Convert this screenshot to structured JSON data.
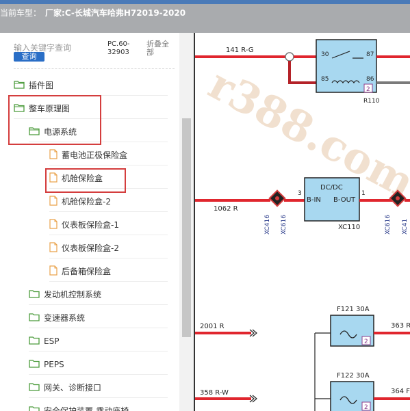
{
  "header": {
    "label": "当前车型：",
    "manufacturer": "厂家:C-长城汽车哈弗H72019-2020"
  },
  "search": {
    "placeholder": "输入关键字查询",
    "button_label": "查询",
    "pc_label": "PC.60-32903",
    "fold_all_label": "折叠全部"
  },
  "tree": {
    "items": [
      {
        "label": "插件图",
        "type": "folder"
      },
      {
        "label": "整车原理图",
        "type": "folder"
      },
      {
        "label": "电源系统",
        "type": "folder"
      },
      {
        "label": "蓄电池正极保险盒",
        "type": "file"
      },
      {
        "label": "机舱保险盒",
        "type": "file"
      },
      {
        "label": "机舱保险盒-2",
        "type": "file"
      },
      {
        "label": "仪表板保险盒-1",
        "type": "file"
      },
      {
        "label": "仪表板保险盒-2",
        "type": "file"
      },
      {
        "label": "后备箱保险盒",
        "type": "file"
      },
      {
        "label": "发动机控制系统",
        "type": "folder"
      },
      {
        "label": "变速器系统",
        "type": "folder"
      },
      {
        "label": "ESP",
        "type": "folder"
      },
      {
        "label": "PEPS",
        "type": "folder"
      },
      {
        "label": "网关、诊断接口",
        "type": "folder"
      },
      {
        "label": "安全保护装置-乘动座椅",
        "type": "folder"
      }
    ]
  },
  "diagram": {
    "relay_name": "R110",
    "relay_pins": [
      "30",
      "87",
      "85",
      "86"
    ],
    "relay_badge": "2",
    "wire_top": "141 R-G",
    "dcdc_title": "DC/DC",
    "dcdc_in": "B-IN",
    "dcdc_out": "B-OUT",
    "dcdc_name": "XC110",
    "dcdc_pin_in": "3",
    "dcdc_pin_out": "1",
    "wire_mid": "1062 R",
    "conn_left_a": "XC416",
    "conn_left_b": "XC616",
    "conn_right_a": "XC616",
    "conn_right_b": "XC41",
    "fuse1_label": "F121 30A",
    "fuse1_badge": "2",
    "fuse2_label": "F122 30A",
    "fuse2_badge": "2",
    "wire_f1_in": "2001 R",
    "wire_f1_out": "363 R",
    "wire_f2_in": "358 R-W",
    "wire_f2_out": "364 F",
    "watermark": "r388.com"
  },
  "colors": {
    "wire_red": "#e0262e",
    "box_fill": "#a8d8f0",
    "highlight_red": "#d43d3d",
    "folder_green": "#4a9b3a",
    "file_orange": "#e9a24a"
  }
}
